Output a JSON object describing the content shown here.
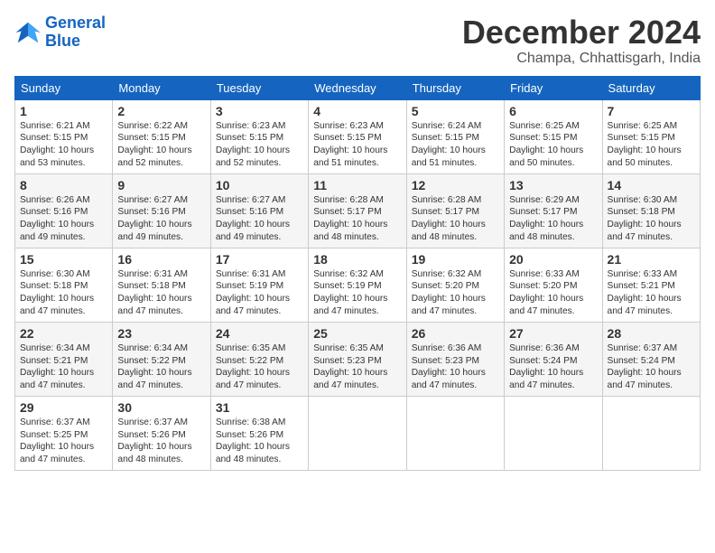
{
  "logo": {
    "line1": "General",
    "line2": "Blue"
  },
  "title": "December 2024",
  "location": "Champa, Chhattisgarh, India",
  "weekdays": [
    "Sunday",
    "Monday",
    "Tuesday",
    "Wednesday",
    "Thursday",
    "Friday",
    "Saturday"
  ],
  "weeks": [
    [
      {
        "day": "1",
        "info": "Sunrise: 6:21 AM\nSunset: 5:15 PM\nDaylight: 10 hours\nand 53 minutes."
      },
      {
        "day": "2",
        "info": "Sunrise: 6:22 AM\nSunset: 5:15 PM\nDaylight: 10 hours\nand 52 minutes."
      },
      {
        "day": "3",
        "info": "Sunrise: 6:23 AM\nSunset: 5:15 PM\nDaylight: 10 hours\nand 52 minutes."
      },
      {
        "day": "4",
        "info": "Sunrise: 6:23 AM\nSunset: 5:15 PM\nDaylight: 10 hours\nand 51 minutes."
      },
      {
        "day": "5",
        "info": "Sunrise: 6:24 AM\nSunset: 5:15 PM\nDaylight: 10 hours\nand 51 minutes."
      },
      {
        "day": "6",
        "info": "Sunrise: 6:25 AM\nSunset: 5:15 PM\nDaylight: 10 hours\nand 50 minutes."
      },
      {
        "day": "7",
        "info": "Sunrise: 6:25 AM\nSunset: 5:15 PM\nDaylight: 10 hours\nand 50 minutes."
      }
    ],
    [
      {
        "day": "8",
        "info": "Sunrise: 6:26 AM\nSunset: 5:16 PM\nDaylight: 10 hours\nand 49 minutes."
      },
      {
        "day": "9",
        "info": "Sunrise: 6:27 AM\nSunset: 5:16 PM\nDaylight: 10 hours\nand 49 minutes."
      },
      {
        "day": "10",
        "info": "Sunrise: 6:27 AM\nSunset: 5:16 PM\nDaylight: 10 hours\nand 49 minutes."
      },
      {
        "day": "11",
        "info": "Sunrise: 6:28 AM\nSunset: 5:17 PM\nDaylight: 10 hours\nand 48 minutes."
      },
      {
        "day": "12",
        "info": "Sunrise: 6:28 AM\nSunset: 5:17 PM\nDaylight: 10 hours\nand 48 minutes."
      },
      {
        "day": "13",
        "info": "Sunrise: 6:29 AM\nSunset: 5:17 PM\nDaylight: 10 hours\nand 48 minutes."
      },
      {
        "day": "14",
        "info": "Sunrise: 6:30 AM\nSunset: 5:18 PM\nDaylight: 10 hours\nand 47 minutes."
      }
    ],
    [
      {
        "day": "15",
        "info": "Sunrise: 6:30 AM\nSunset: 5:18 PM\nDaylight: 10 hours\nand 47 minutes."
      },
      {
        "day": "16",
        "info": "Sunrise: 6:31 AM\nSunset: 5:18 PM\nDaylight: 10 hours\nand 47 minutes."
      },
      {
        "day": "17",
        "info": "Sunrise: 6:31 AM\nSunset: 5:19 PM\nDaylight: 10 hours\nand 47 minutes."
      },
      {
        "day": "18",
        "info": "Sunrise: 6:32 AM\nSunset: 5:19 PM\nDaylight: 10 hours\nand 47 minutes."
      },
      {
        "day": "19",
        "info": "Sunrise: 6:32 AM\nSunset: 5:20 PM\nDaylight: 10 hours\nand 47 minutes."
      },
      {
        "day": "20",
        "info": "Sunrise: 6:33 AM\nSunset: 5:20 PM\nDaylight: 10 hours\nand 47 minutes."
      },
      {
        "day": "21",
        "info": "Sunrise: 6:33 AM\nSunset: 5:21 PM\nDaylight: 10 hours\nand 47 minutes."
      }
    ],
    [
      {
        "day": "22",
        "info": "Sunrise: 6:34 AM\nSunset: 5:21 PM\nDaylight: 10 hours\nand 47 minutes."
      },
      {
        "day": "23",
        "info": "Sunrise: 6:34 AM\nSunset: 5:22 PM\nDaylight: 10 hours\nand 47 minutes."
      },
      {
        "day": "24",
        "info": "Sunrise: 6:35 AM\nSunset: 5:22 PM\nDaylight: 10 hours\nand 47 minutes."
      },
      {
        "day": "25",
        "info": "Sunrise: 6:35 AM\nSunset: 5:23 PM\nDaylight: 10 hours\nand 47 minutes."
      },
      {
        "day": "26",
        "info": "Sunrise: 6:36 AM\nSunset: 5:23 PM\nDaylight: 10 hours\nand 47 minutes."
      },
      {
        "day": "27",
        "info": "Sunrise: 6:36 AM\nSunset: 5:24 PM\nDaylight: 10 hours\nand 47 minutes."
      },
      {
        "day": "28",
        "info": "Sunrise: 6:37 AM\nSunset: 5:24 PM\nDaylight: 10 hours\nand 47 minutes."
      }
    ],
    [
      {
        "day": "29",
        "info": "Sunrise: 6:37 AM\nSunset: 5:25 PM\nDaylight: 10 hours\nand 47 minutes."
      },
      {
        "day": "30",
        "info": "Sunrise: 6:37 AM\nSunset: 5:26 PM\nDaylight: 10 hours\nand 48 minutes."
      },
      {
        "day": "31",
        "info": "Sunrise: 6:38 AM\nSunset: 5:26 PM\nDaylight: 10 hours\nand 48 minutes."
      },
      null,
      null,
      null,
      null
    ]
  ]
}
